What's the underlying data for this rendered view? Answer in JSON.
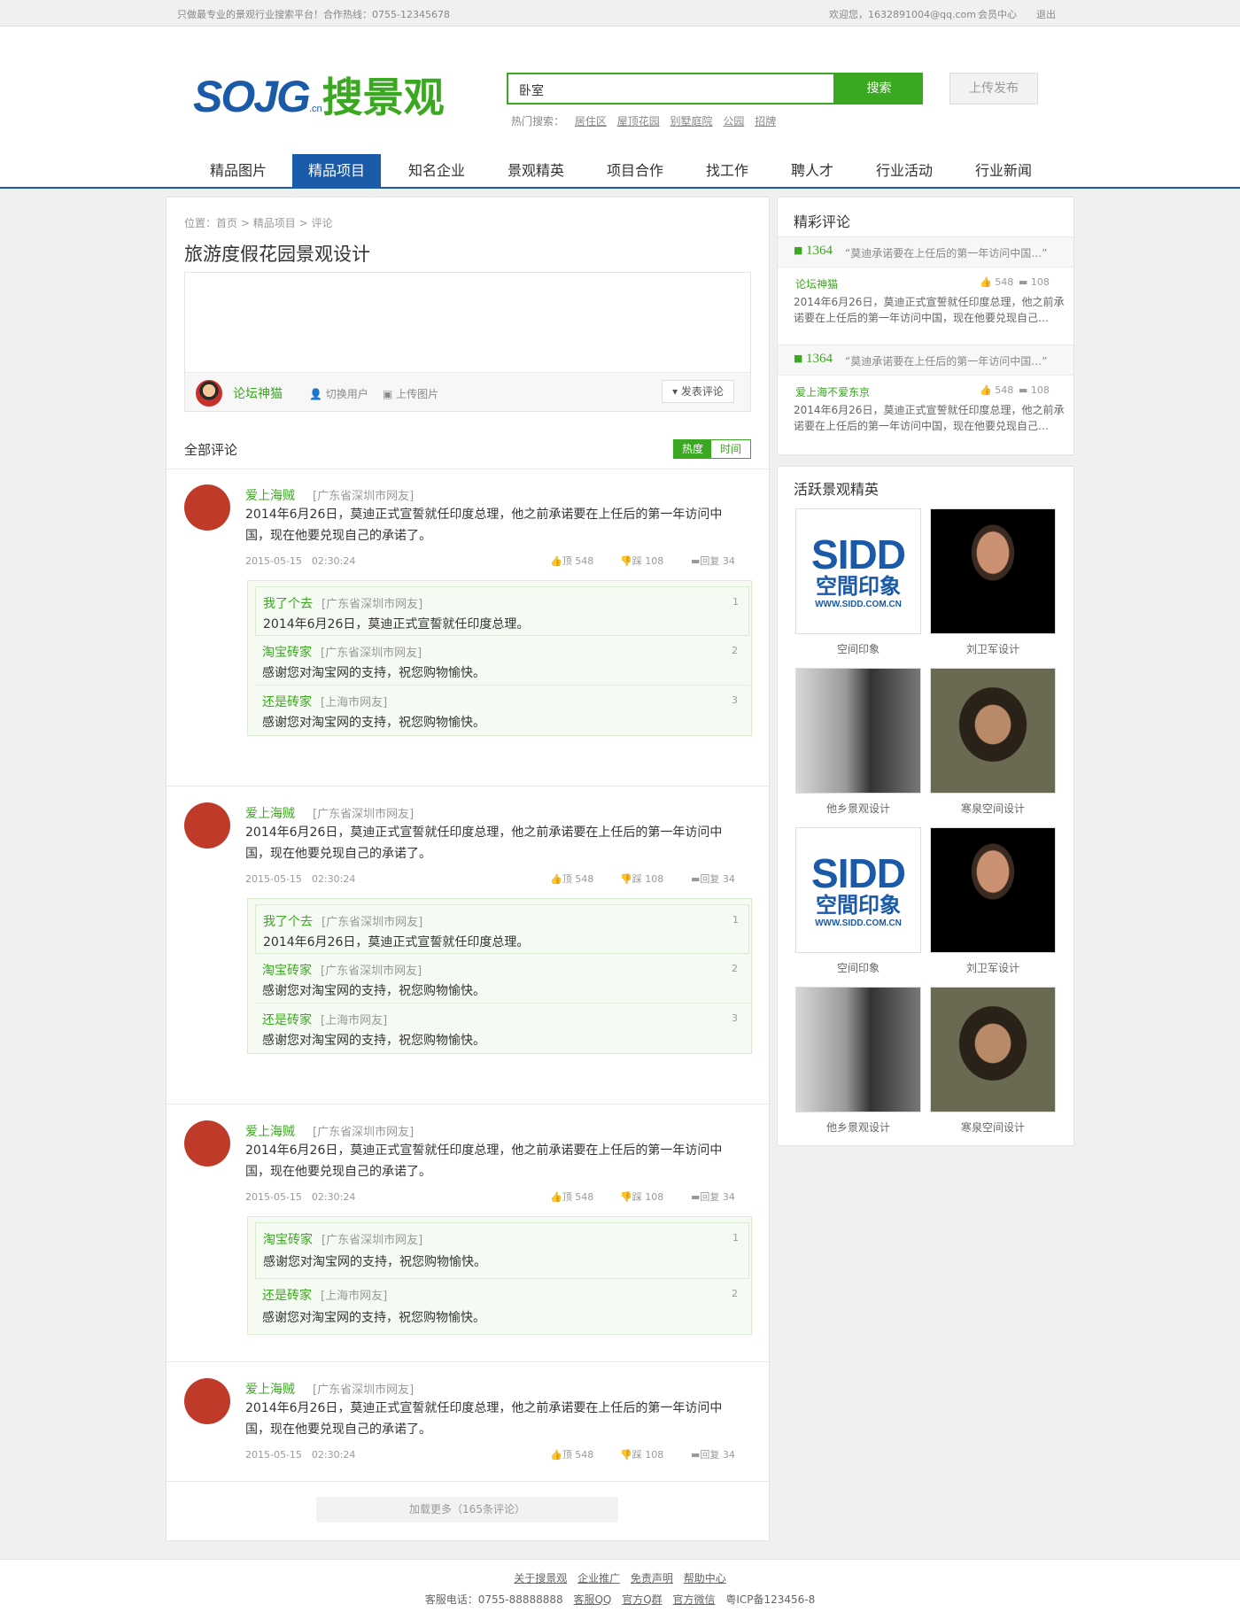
{
  "topbar": {
    "slogan": "只做最专业的景观行业搜索平台！合作热线：0755-12345678",
    "welcome": "欢迎您，1632891004@qq.com",
    "member": "会员中心",
    "logout": "退出"
  },
  "header": {
    "logo_en": "SOJG",
    "logo_cn_small": ".cn",
    "logo_zh": "搜景观",
    "search_value": "卧室",
    "search_button": "搜索",
    "upload_button": "上传发布",
    "hot_label": "热门搜索：",
    "hot": [
      "居住区",
      "屋顶花园",
      "别墅庭院",
      "公园",
      "招牌"
    ]
  },
  "nav": [
    "精品图片",
    "精品项目",
    "知名企业",
    "景观精英",
    "项目合作",
    "找工作",
    "聘人才",
    "行业活动",
    "行业新闻"
  ],
  "main": {
    "crumb_label": "位置：",
    "crumbs": [
      "首页",
      "精品项目",
      "评论"
    ],
    "title": "旅游度假花园景观设计",
    "editor": {
      "user": "论坛神猫",
      "switch": "切换用户",
      "upload": "上传图片",
      "post": "发表评论"
    },
    "all_label": "全部评论",
    "tabs": [
      "热度",
      "时间"
    ],
    "comments": [
      {
        "name": "爱上海贼",
        "loc": "[广东省深圳市网友]",
        "text1": "2014年6月26日，莫迪正式宣誓就任印度总理，他之前承诺要在上任后的第一年访问中",
        "text2": "国，现在他要兑现自己的承诺了。",
        "date": "2015-05-15　02:30:24",
        "up_label": "顶",
        "up": "548",
        "down_label": "踩",
        "down": "108",
        "reply_label": "回复",
        "reply": "34",
        "replies": [
          {
            "name": "我了个去",
            "loc": "[广东省深圳市网友]",
            "text": "2014年6月26日，莫迪正式宣誓就任印度总理。",
            "n": "1"
          },
          {
            "name": "淘宝砖家",
            "loc": "[广东省深圳市网友]",
            "text": "感谢您对淘宝网的支持，祝您购物愉快。",
            "n": "2"
          },
          {
            "name": "还是砖家",
            "loc": "[上海市网友]",
            "text": "感谢您对淘宝网的支持，祝您购物愉快。",
            "n": "3"
          }
        ]
      },
      {
        "name": "爱上海贼",
        "loc": "[广东省深圳市网友]",
        "text1": "2014年6月26日，莫迪正式宣誓就任印度总理，他之前承诺要在上任后的第一年访问中",
        "text2": "国，现在他要兑现自己的承诺了。",
        "date": "2015-05-15　02:30:24",
        "up_label": "顶",
        "up": "548",
        "down_label": "踩",
        "down": "108",
        "reply_label": "回复",
        "reply": "34",
        "replies": [
          {
            "name": "我了个去",
            "loc": "[广东省深圳市网友]",
            "text": "2014年6月26日，莫迪正式宣誓就任印度总理。",
            "n": "1"
          },
          {
            "name": "淘宝砖家",
            "loc": "[广东省深圳市网友]",
            "text": "感谢您对淘宝网的支持，祝您购物愉快。",
            "n": "2"
          },
          {
            "name": "还是砖家",
            "loc": "[上海市网友]",
            "text": "感谢您对淘宝网的支持，祝您购物愉快。",
            "n": "3"
          }
        ]
      },
      {
        "name": "爱上海贼",
        "loc": "[广东省深圳市网友]",
        "text1": "2014年6月26日，莫迪正式宣誓就任印度总理，他之前承诺要在上任后的第一年访问中",
        "text2": "国，现在他要兑现自己的承诺了。",
        "date": "2015-05-15　02:30:24",
        "up_label": "顶",
        "up": "548",
        "down_label": "踩",
        "down": "108",
        "reply_label": "回复",
        "reply": "34",
        "replies": [
          {
            "name": "淘宝砖家",
            "loc": "[广东省深圳市网友]",
            "text": "感谢您对淘宝网的支持，祝您购物愉快。",
            "n": "1"
          },
          {
            "name": "还是砖家",
            "loc": "[上海市网友]",
            "text": "感谢您对淘宝网的支持，祝您购物愉快。",
            "n": "2"
          }
        ]
      },
      {
        "name": "爱上海贼",
        "loc": "[广东省深圳市网友]",
        "text1": "2014年6月26日，莫迪正式宣誓就任印度总理，他之前承诺要在上任后的第一年访问中",
        "text2": "国，现在他要兑现自己的承诺了。",
        "date": "2015-05-15　02:30:24",
        "up_label": "顶",
        "up": "548",
        "down_label": "踩",
        "down": "108",
        "reply_label": "回复",
        "reply": "34",
        "replies": []
      }
    ],
    "more": "加载更多（165条评论）"
  },
  "side": {
    "hot_title": "精彩评论",
    "hot": [
      {
        "count": "1364",
        "quote": "“莫迪承诺要在上任后的第一年访问中国…”",
        "user": "论坛神猫",
        "up": "548",
        "down": "108",
        "text1": "2014年6月26日，莫迪正式宣誓就任印度总理，他之前承",
        "text2": "诺要在上任后的第一年访问中国，现在他要兑现自己…"
      },
      {
        "count": "1364",
        "quote": "“莫迪承诺要在上任后的第一年访问中国…”",
        "user": "爱上海不爱东京",
        "up": "548",
        "down": "108",
        "text1": "2014年6月26日，莫迪正式宣誓就任印度总理，他之前承",
        "text2": "诺要在上任后的第一年访问中国，现在他要兑现自己…"
      }
    ],
    "active_title": "活跃景观精英",
    "sidd_big": "SIDD",
    "sidd_zh": "空間印象",
    "sidd_url": "WWW.SIDD.COM.CN",
    "people": [
      "空间印象",
      "刘卫军设计",
      "他乡景观设计",
      "寒泉空间设计",
      "空间印象",
      "刘卫军设计",
      "他乡景观设计",
      "寒泉空间设计"
    ]
  },
  "footer": {
    "links": [
      "关于搜景观",
      "企业推广",
      "免责声明",
      "帮助中心"
    ],
    "phone": "客服电话：0755-88888888",
    "links2": [
      "客服QQ",
      "官方Q群",
      "官方微信"
    ],
    "icp": "粤ICP备123456-8"
  }
}
